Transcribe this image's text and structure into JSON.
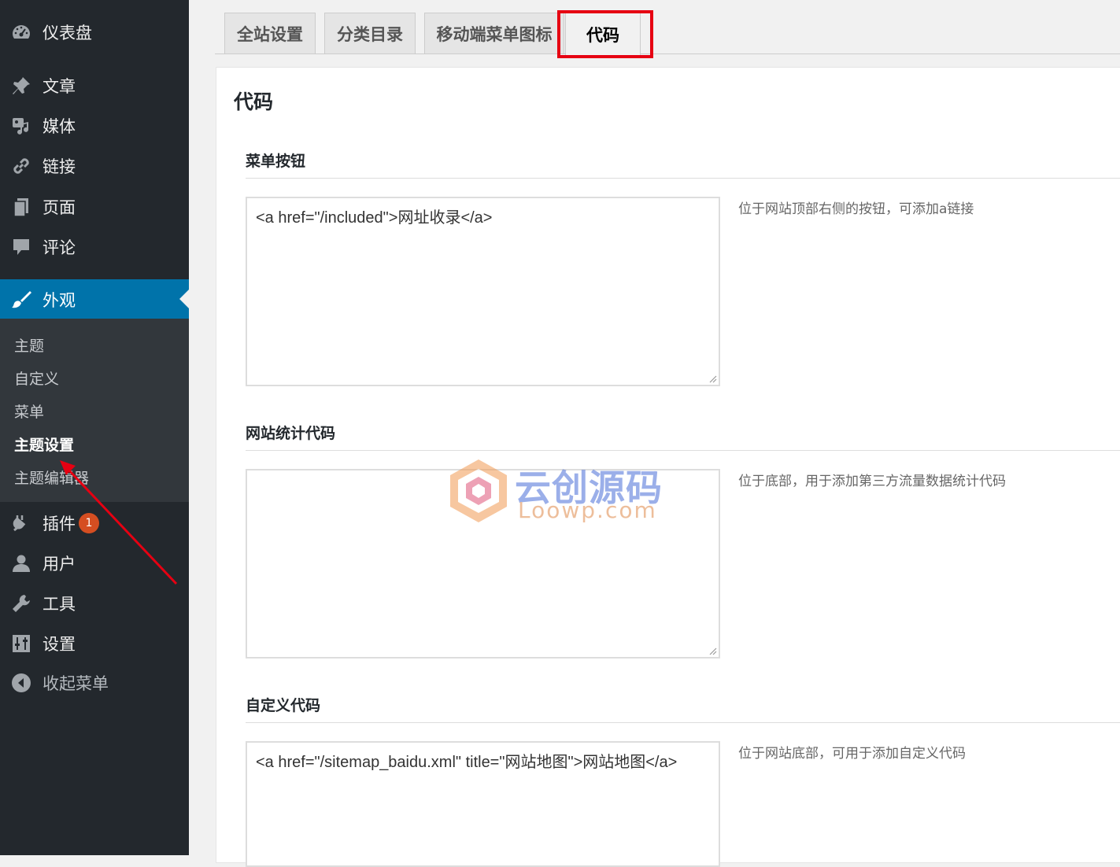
{
  "sidebar": {
    "items": [
      {
        "label": "仪表盘",
        "icon": "dashboard-icon"
      },
      {
        "label": "文章",
        "icon": "pushpin-icon"
      },
      {
        "label": "媒体",
        "icon": "media-icon"
      },
      {
        "label": "链接",
        "icon": "link-icon"
      },
      {
        "label": "页面",
        "icon": "page-icon"
      },
      {
        "label": "评论",
        "icon": "comment-icon"
      },
      {
        "label": "外观",
        "icon": "appearance-brush-icon"
      },
      {
        "label": "插件",
        "icon": "plugin-icon",
        "badge": "1"
      },
      {
        "label": "用户",
        "icon": "user-icon"
      },
      {
        "label": "工具",
        "icon": "wrench-icon"
      },
      {
        "label": "设置",
        "icon": "settings-icon"
      },
      {
        "label": "收起菜单",
        "icon": "collapse-icon"
      }
    ],
    "submenu": [
      "主题",
      "自定义",
      "菜单",
      "主题设置",
      "主题编辑器"
    ],
    "active_color": "#0073aa"
  },
  "tabs": [
    "全站设置",
    "分类目录",
    "移动端菜单图标",
    "代码"
  ],
  "active_tab": "代码",
  "panel": {
    "title": "代码",
    "sections": [
      {
        "title": "菜单按钮",
        "value": "<a href=\"/included\">网址收录</a>",
        "description": "位于网站顶部右侧的按钮，可添加a链接"
      },
      {
        "title": "网站统计代码",
        "value": "",
        "description": "位于底部，用于添加第三方流量数据统计代码"
      },
      {
        "title": "自定义代码",
        "value": "<a href=\"/sitemap_baidu.xml\" title=\"网站地图\">网站地图</a>",
        "description": "位于网站底部，可用于添加自定义代码"
      }
    ]
  },
  "watermark": {
    "text": "云创源码",
    "sub": "Loowp.com"
  },
  "annotation_color": "#e60012"
}
